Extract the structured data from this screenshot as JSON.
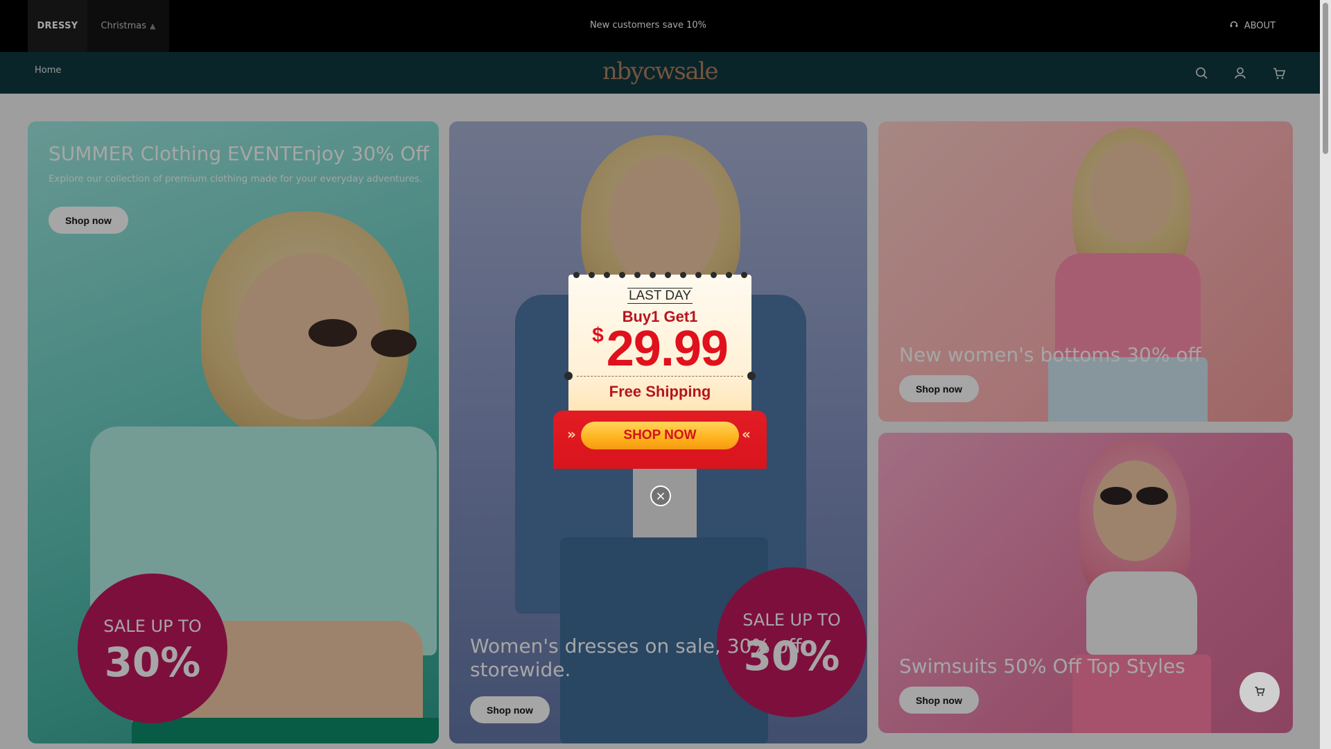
{
  "store_tabs": [
    {
      "label": "DRESSY",
      "icon": ""
    },
    {
      "label": "Christmas",
      "icon": "tree-icon"
    }
  ],
  "announcement": "New customers save 10%",
  "about": {
    "label": "ABOUT",
    "icon": "headset-icon"
  },
  "nav": {
    "home": "Home",
    "logo": "nbycwsale",
    "icons": [
      "search-icon",
      "user-icon",
      "cart-icon"
    ]
  },
  "banners": {
    "summer": {
      "title": "SUMMER Clothing EVENTEnjoy 30% Off",
      "subtitle": "Explore our collection of premium clothing made for your everyday adventures.",
      "button": "Shop now",
      "badge_line1": "SALE UP TO",
      "badge_line2": "30%"
    },
    "dresses": {
      "title_line1": "Women's dresses on sale, 30% off",
      "title_line2": "storewide.",
      "button": "Shop now",
      "badge_line1": "SALE UP TO",
      "badge_line2": "30%"
    },
    "bottoms": {
      "title": "New women's bottoms 30% off",
      "button": "Shop now"
    },
    "swimsuits": {
      "title": "Swimsuits 50% Off Top Styles",
      "button": "Shop now"
    }
  },
  "popup": {
    "last_day": "LAST DAY",
    "offer": "Buy1 Get1",
    "currency": "$",
    "price": "29.99",
    "shipping": "Free Shipping",
    "button": "SHOP NOW",
    "close_icon": "close-icon"
  },
  "floating_cart_icon": "cart-icon",
  "colors": {
    "topbar": "#000000",
    "navbar": "#10393f",
    "logo": "#b38163",
    "sale_badge": "#c0185e",
    "popup_red": "#e31c24",
    "popup_button": "#ffb21d"
  }
}
